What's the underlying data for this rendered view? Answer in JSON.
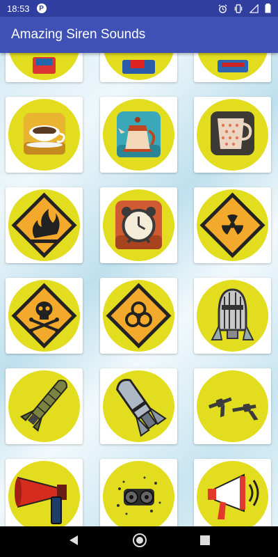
{
  "status_bar": {
    "time": "18:53",
    "app_badge": "P",
    "icons": [
      "alarm-icon",
      "vibrate-icon",
      "signal-icon",
      "battery-icon"
    ]
  },
  "app_bar": {
    "title": "Amazing Siren Sounds"
  },
  "grid": {
    "rows": [
      [
        "partial-icon",
        "partial-icon",
        "partial-icon"
      ],
      [
        "coffee-cup-icon",
        "teapot-icon",
        "tea-mug-icon"
      ],
      [
        "fire-warning-icon",
        "alarm-clock-icon",
        "radiation-warning-icon"
      ],
      [
        "skull-warning-icon",
        "biohazard-warning-icon",
        "nuclear-bomb-icon"
      ],
      [
        "missile-icon",
        "aerial-bomb-icon",
        "revolvers-icon"
      ],
      [
        "air-horn-icon",
        "speaker-icon",
        "megaphone-icon"
      ]
    ]
  },
  "nav_bar": {
    "buttons": [
      "back-icon",
      "home-icon",
      "recents-icon"
    ]
  },
  "colors": {
    "status_bar": "#303f9f",
    "app_bar": "#3f51b5",
    "tile_circle": "#e2dd1e"
  }
}
